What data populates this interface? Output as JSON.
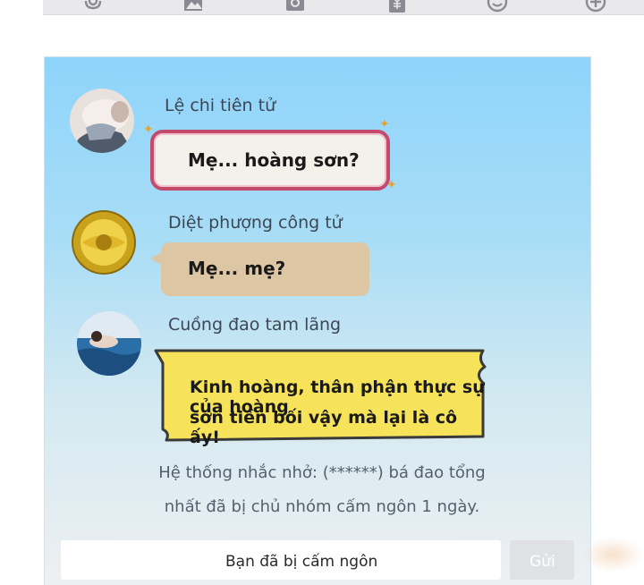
{
  "toolbar": {
    "icons": [
      "microphone-icon",
      "image-icon",
      "camera-icon",
      "red-packet-icon",
      "emoji-icon",
      "plus-icon"
    ]
  },
  "messages": [
    {
      "sender": "Lệ chi tiên tử",
      "text": "Mẹ... hoàng sơn?",
      "bubble_color": "#f4f0ea",
      "border_color": "#c44a6c"
    },
    {
      "sender": "Diệt phượng công tử",
      "text": "Mẹ... mẹ?",
      "bubble_color": "#dcc6a4"
    },
    {
      "sender": "Cuồng đao tam lãng",
      "text_lines": [
        "Kinh hoàng, thân phận thực sự của hoàng",
        "sơn tiền bối vậy mà lại là cô ấy!"
      ],
      "bubble_color": "#f7e35a",
      "border_color": "#3a3a3a"
    }
  ],
  "system_notice": {
    "line1": "Hệ thống nhắc nhở: (******) bá đao tổng",
    "line2": "nhất đã bị chủ nhóm cấm ngôn 1 ngày."
  },
  "input": {
    "muted_text": "Bạn đã bị cấm ngôn",
    "send_label": "Gửi"
  },
  "colors": {
    "chat_bg_top": "#8ed4fb",
    "chat_bg_bottom": "#eef0f2",
    "name_text": "#3d4754",
    "system_text": "#53606e"
  }
}
